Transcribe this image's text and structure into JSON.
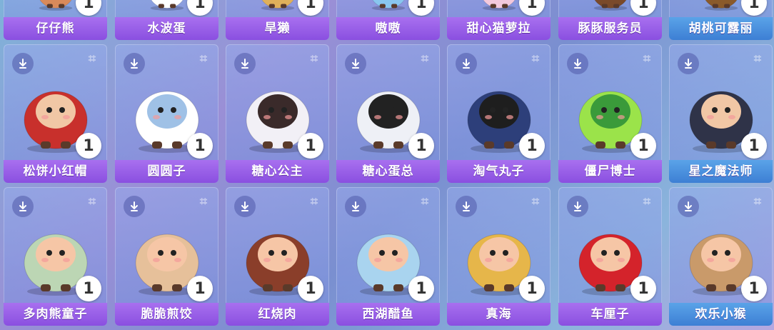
{
  "grid": {
    "columns": 7,
    "rows": [
      {
        "items": [
          {
            "name": "仔仔熊",
            "count": "1",
            "color": "#d98a5a",
            "acc": "#f1c7a5"
          },
          {
            "name": "水波蛋",
            "count": "1",
            "color": "#ffffff",
            "acc": "#f6c6a6"
          },
          {
            "name": "旱獭",
            "count": "1",
            "color": "#e0b05a",
            "acc": "#f1c7a5"
          },
          {
            "name": "嗷嗷",
            "count": "1",
            "color": "#89c6ef",
            "acc": "#ffffff"
          },
          {
            "name": "甜心猫萝拉",
            "count": "1",
            "color": "#f3c9dc",
            "acc": "#ffffff"
          },
          {
            "name": "豚豚服务员",
            "count": "1",
            "color": "#7a4a2a",
            "acc": "#f1c7a5"
          },
          {
            "name": "胡桃可露丽",
            "count": "1",
            "color": "#8a5a2a",
            "acc": "#f1c7a5"
          }
        ]
      },
      {
        "items": [
          {
            "name": "松饼小红帽",
            "count": "1",
            "color": "#c8302c",
            "acc": "#f1c7a5"
          },
          {
            "name": "圆圆子",
            "count": "1",
            "color": "#ffffff",
            "acc": "#9fc1e6"
          },
          {
            "name": "糖心公主",
            "count": "1",
            "color": "#f2f0f6",
            "acc": "#3a2a2a"
          },
          {
            "name": "糖心蛋总",
            "count": "1",
            "color": "#eef0f6",
            "acc": "#222222"
          },
          {
            "name": "淘气丸子",
            "count": "1",
            "color": "#2d3f7a",
            "acc": "#1e1e1e"
          },
          {
            "name": "僵尸博士",
            "count": "1",
            "color": "#9be34a",
            "acc": "#3a9a3a"
          },
          {
            "name": "星之魔法师",
            "count": "1",
            "color": "#2f3348",
            "acc": "#f1c7a5"
          }
        ]
      },
      {
        "items": [
          {
            "name": "多肉熊童子",
            "count": "1",
            "color": "#bcd6b4",
            "acc": "#f6c6a6"
          },
          {
            "name": "脆脆煎饺",
            "count": "1",
            "color": "#e6c09a",
            "acc": "#f6c6a6"
          },
          {
            "name": "红烧肉",
            "count": "1",
            "color": "#8a3e2a",
            "acc": "#f6c6a6"
          },
          {
            "name": "西湖醋鱼",
            "count": "1",
            "color": "#a9d4ef",
            "acc": "#f6c6a6"
          },
          {
            "name": "真海",
            "count": "1",
            "color": "#e6b64a",
            "acc": "#f6c6a6"
          },
          {
            "name": "车厘子",
            "count": "1",
            "color": "#d4232b",
            "acc": "#f6c6a6"
          },
          {
            "name": "欢乐小猴",
            "count": "1",
            "color": "#c99a6a",
            "acc": "#f6c6a6"
          }
        ]
      }
    ]
  }
}
